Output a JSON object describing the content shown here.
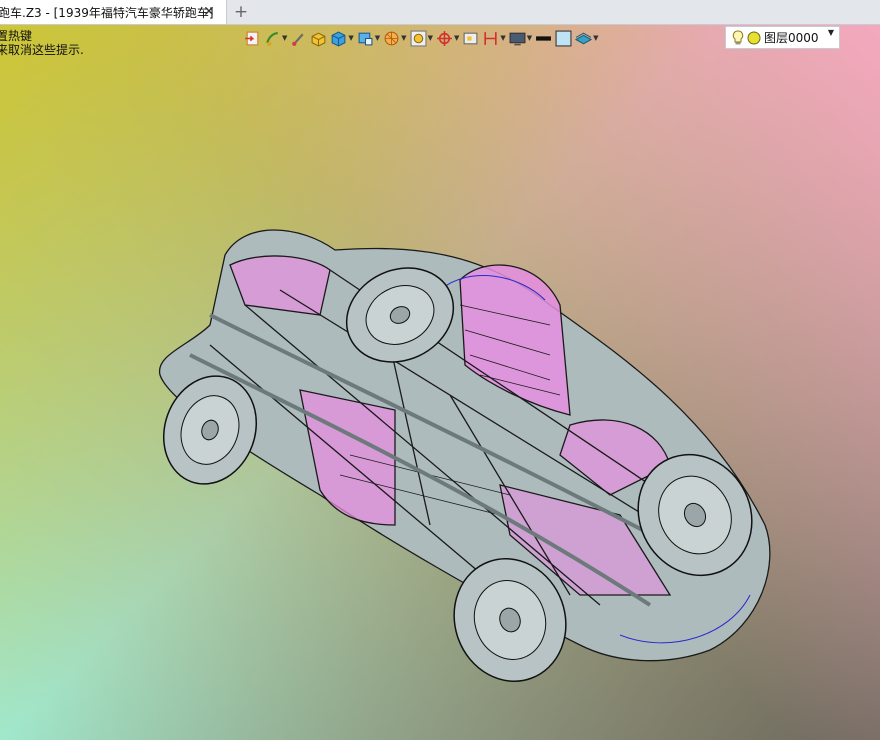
{
  "tab": {
    "title": "跑车.Z3 - [1939年福特汽车豪华轿跑车]",
    "close_icon": "close-icon",
    "new_tab_icon": "plus-icon"
  },
  "hint": {
    "line1": "置热键",
    "line2": "来取消这些提示."
  },
  "toolbar": {
    "tools": [
      "import-icon",
      "paint-icon",
      "brush-icon",
      "solid-box-icon",
      "cube-icon",
      "view-cube-icon",
      "sphere-icon",
      "zoom-fit-icon",
      "crosshair-icon",
      "frame-icon",
      "dimension-icon",
      "monitor-icon",
      "line-style-icon",
      "color-swatch-icon",
      "layers-icon"
    ],
    "layer_name": "图层0000"
  },
  "colors": {
    "accent_pink": "#e58ee0",
    "body_gray": "#aebbbd"
  }
}
